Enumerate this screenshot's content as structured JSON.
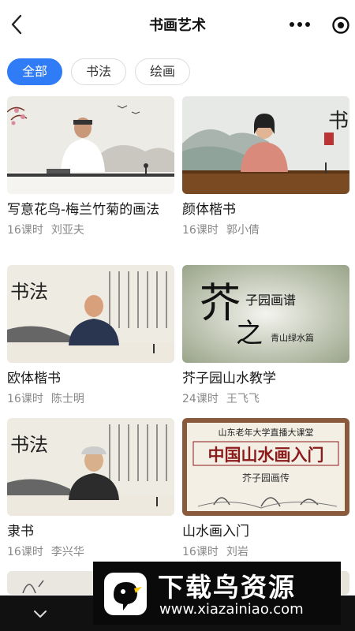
{
  "header": {
    "title": "书画艺术",
    "back_icon": "chevron-left-icon",
    "more_icon": "more-dots-icon",
    "target_icon": "target-icon"
  },
  "tabs": [
    {
      "label": "全部",
      "active": true
    },
    {
      "label": "书法",
      "active": false
    },
    {
      "label": "绘画",
      "active": false
    }
  ],
  "courses": [
    {
      "title": "写意花鸟-梅兰竹菊的画法",
      "lessons": "16课时",
      "teacher": "刘亚夫",
      "thumb_text": ""
    },
    {
      "title": "颜体楷书",
      "lessons": "16课时",
      "teacher": "郭小倩",
      "thumb_text": "书法"
    },
    {
      "title": "欧体楷书",
      "lessons": "16课时",
      "teacher": "陈士明",
      "thumb_text": "书法"
    },
    {
      "title": "芥子园山水教学",
      "lessons": "24课时",
      "teacher": "王飞飞",
      "thumb_text": "芥子园画谱",
      "thumb_sub": "青山绿水篇"
    },
    {
      "title": "隶书",
      "lessons": "16课时",
      "teacher": "李兴华",
      "thumb_text": "书法"
    },
    {
      "title": "山水画入门",
      "lessons": "16课时",
      "teacher": "刘岩",
      "thumb_header": "山东老年大学直播大课堂",
      "thumb_text": "中国山水画入门",
      "thumb_sub": "芥子园画传"
    }
  ],
  "bottom_bar": {
    "icon": "chevron-down-icon"
  },
  "watermark": {
    "title": "下载鸟资源",
    "url": "www.xiazainiao.com",
    "logo": "bird-logo-icon"
  },
  "colors": {
    "accent": "#2f7cf6",
    "meta": "#888888",
    "watermark_bg": "#0a0a0a"
  }
}
